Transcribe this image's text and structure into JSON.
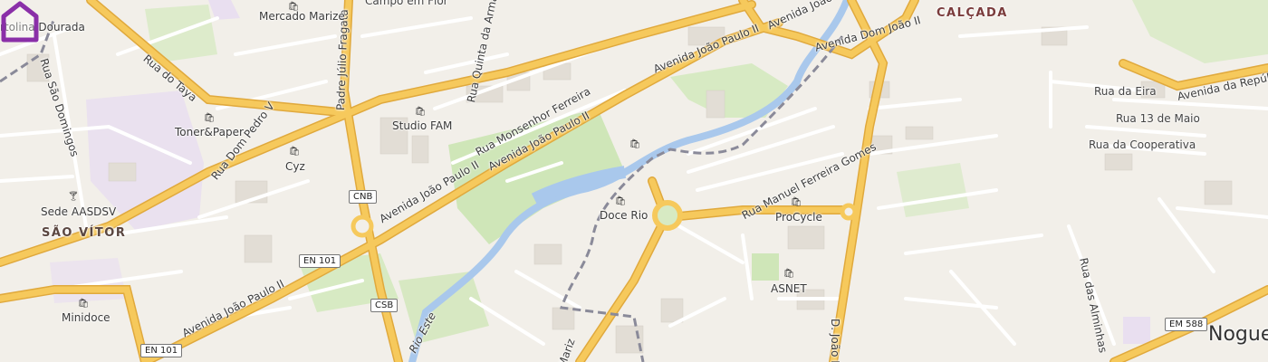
{
  "areas": [
    {
      "id": "sao-vitor",
      "label": "SÃO VÍTOR"
    },
    {
      "id": "calcada",
      "label": "CALÇADA"
    },
    {
      "id": "nogueira",
      "label": "Nogue"
    }
  ],
  "streets": [
    {
      "id": "av-joao-paulo-ii-1",
      "label": "Avenida João Paulo II"
    },
    {
      "id": "av-joao-paulo-ii-2",
      "label": "Avenida João Paulo II"
    },
    {
      "id": "av-joao-paulo-ii-3",
      "label": "Avenida João Paulo II"
    },
    {
      "id": "av-joao-paulo-ii-4",
      "label": "Avenida João Paulo II"
    },
    {
      "id": "av-joao-paulo-ii-5",
      "label": "Avenida João Paulo II"
    },
    {
      "id": "rua-monsenhor-ferreira",
      "label": "Rua Monsenhor Ferreira"
    },
    {
      "id": "rua-dom-pedro-v",
      "label": "Rua Dom Pedro V"
    },
    {
      "id": "rua-do-taya",
      "label": "Rua do Taya"
    },
    {
      "id": "rua-sao-domingos",
      "label": "Rua São Domingos"
    },
    {
      "id": "padre-julio-fragata",
      "label": "Padre Júlio Fragata"
    },
    {
      "id": "rua-quinta-da-armada",
      "label": "Rua Quinta da Armada"
    },
    {
      "id": "avenida-dom-joao-ii-1",
      "label": "Avenida Dom João II"
    },
    {
      "id": "avenida-dom-joao-ii-2",
      "label": "D. João II"
    },
    {
      "id": "rua-manuel-ferreira-gomes",
      "label": "Rua Manuel Ferreira Gomes"
    },
    {
      "id": "rua-da-eira",
      "label": "Rua da Eira"
    },
    {
      "id": "rua-13-de-maio",
      "label": "Rua 13 de Maio"
    },
    {
      "id": "rua-da-cooperativa",
      "label": "Rua da Cooperativa"
    },
    {
      "id": "avenida-da-republica",
      "label": "Avenida da República"
    },
    {
      "id": "rua-das-alminhas",
      "label": "Rua das Alminhas"
    },
    {
      "id": "lower-street",
      "label": "Mariz"
    },
    {
      "id": "campo-em-flor",
      "label": "Campo em Flor"
    }
  ],
  "pois": [
    {
      "id": "mercado-marize",
      "label": "Mercado Marizé"
    },
    {
      "id": "bertolina-dourada",
      "label": "rtolina Dourada"
    },
    {
      "id": "toner-paper",
      "label": "Toner&Paper"
    },
    {
      "id": "studio-fam",
      "label": "Studio FAM"
    },
    {
      "id": "cyz",
      "label": "Cyz"
    },
    {
      "id": "sede-aasdsv",
      "label": "Sede AASDSV"
    },
    {
      "id": "minidoce",
      "label": "Minidoce"
    },
    {
      "id": "doce-rio",
      "label": "Doce Rio"
    },
    {
      "id": "procycle",
      "label": "ProCycle"
    },
    {
      "id": "asnet",
      "label": "ASNET"
    }
  ],
  "shields": [
    {
      "id": "cnb",
      "label": "CNB"
    },
    {
      "id": "en101-a",
      "label": "EN 101"
    },
    {
      "id": "csb",
      "label": "CSB"
    },
    {
      "id": "en101-b",
      "label": "EN 101"
    },
    {
      "id": "em588",
      "label": "EM 588"
    }
  ],
  "water": {
    "label": "Rio Este"
  },
  "colors": {
    "land": "#f2efe9",
    "major_road": "#f6c95c",
    "major_road_casing": "#e0a93d",
    "minor_road": "#ffffff",
    "park": "#cfe6b8",
    "water": "#a9c8ec",
    "building": "#e2ddd5",
    "residential_pink": "#efe2ee",
    "railway": "#8a8a99",
    "marker": "#8a2fa8"
  },
  "icons": {
    "shop": "shopping-bag-icon",
    "bar": "cocktail-icon",
    "marker": "home-pin-icon"
  }
}
